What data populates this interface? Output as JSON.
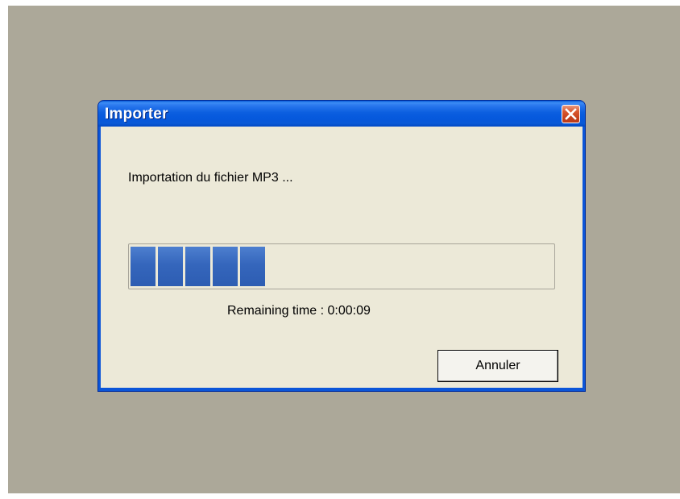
{
  "window": {
    "title": "Importer",
    "close_icon": "close-icon"
  },
  "dialog": {
    "message": "Importation du fichier MP3 ...",
    "progress_percent": 34,
    "progress_segments_filled": 5,
    "remaining_time": "Remaining time : 0:00:09",
    "cancel_label": "Annuler"
  },
  "colors": {
    "desktop": "#aca899",
    "titlebar": "#0b55d8",
    "client": "#ece9d8",
    "progress_fill": "#3566bc",
    "close_button": "#d9572e"
  }
}
